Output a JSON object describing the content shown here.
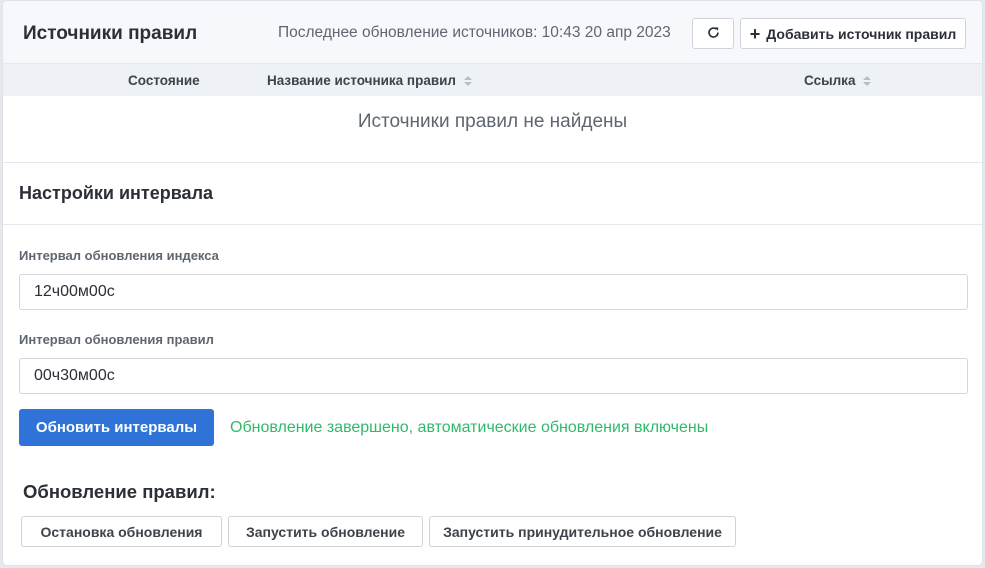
{
  "header": {
    "title": "Источники правил",
    "last_update": "Последнее обновление источников: 10:43 20 апр 2023",
    "refresh_icon": "refresh-icon",
    "add_label": "Добавить источник правил"
  },
  "table": {
    "columns": [
      "Состояние",
      "Название источника правил",
      "Ссылка"
    ],
    "empty_message": "Источники правил не найдены"
  },
  "interval_settings": {
    "title": "Настройки интервала",
    "index_interval_label": "Интервал обновления индекса",
    "index_interval_value": "12ч00м00с",
    "rules_interval_label": "Интервал обновления правил",
    "rules_interval_value": "00ч30м00с",
    "update_button": "Обновить интервалы",
    "status_message": "Обновление завершено, автоматические обновления включены"
  },
  "rules_update": {
    "title": "Обновление правил:",
    "stop_button": "Остановка обновления",
    "start_button": "Запустить обновление",
    "force_button": "Запустить принудительное обновление"
  },
  "colors": {
    "primary": "#2f73d8",
    "success": "#2fba6a"
  }
}
